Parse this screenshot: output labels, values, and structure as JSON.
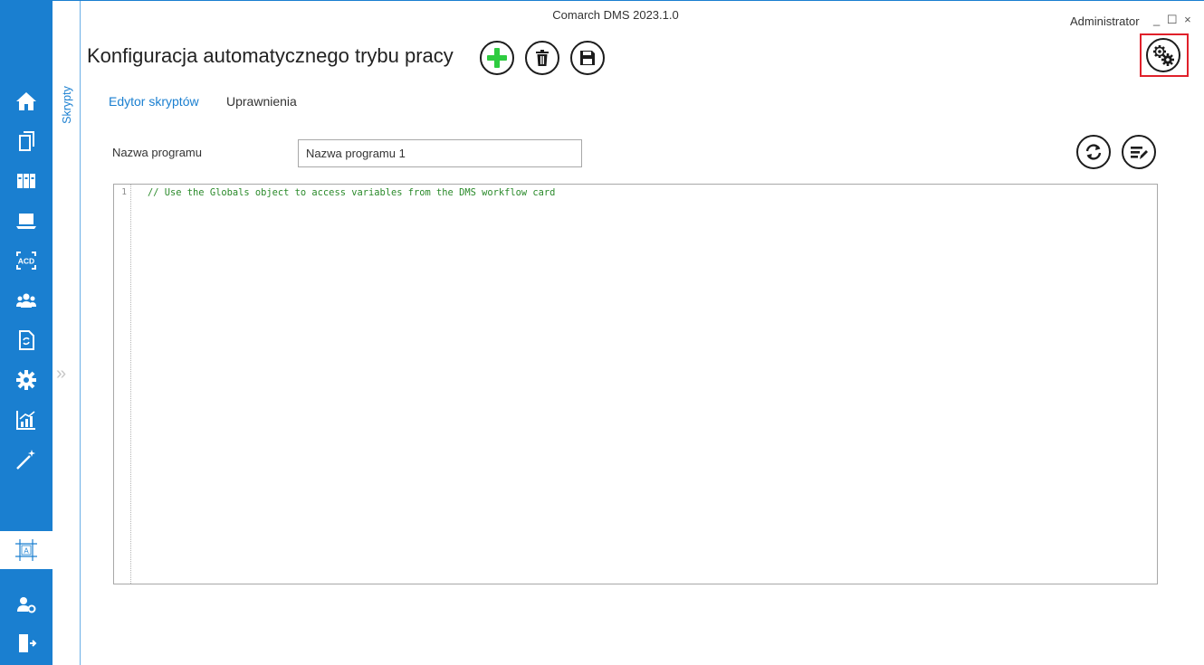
{
  "window": {
    "title": "Comarch DMS 2023.1.0",
    "user": "Administrator",
    "controls": "_ ☐ ×"
  },
  "page": {
    "title": "Konfiguracja automatycznego trybu pracy"
  },
  "toolbar": {
    "add_icon": "plus-icon",
    "delete_icon": "trash-icon",
    "save_icon": "floppy-icon",
    "config_icon": "gears-icon",
    "add_color": "#2ecc40"
  },
  "sidebar": {
    "items": [
      {
        "icon": "home-icon"
      },
      {
        "icon": "documents-icon"
      },
      {
        "icon": "binders-icon"
      },
      {
        "icon": "laptop-icon"
      },
      {
        "icon": "ocr-acd-icon"
      },
      {
        "icon": "users-group-icon"
      },
      {
        "icon": "document-sync-icon"
      },
      {
        "icon": "gear-icon"
      },
      {
        "icon": "chart-icon"
      },
      {
        "icon": "magic-wand-icon"
      },
      {
        "icon": "form-designer-icon",
        "active": true
      },
      {
        "icon": "user-settings-icon"
      },
      {
        "icon": "logout-icon"
      }
    ],
    "accent": "#1a7fd0"
  },
  "side_panel": {
    "tab_label": "Skrypty",
    "expand_icon": "double-chevron-right-icon"
  },
  "tabs": [
    {
      "label": "Edytor skryptów",
      "active": true
    },
    {
      "label": "Uprawnienia",
      "active": false
    }
  ],
  "form": {
    "name_label": "Nazwa programu",
    "name_value": "Nazwa programu 1",
    "refresh_icon": "refresh-icon",
    "format_icon": "format-lines-icon"
  },
  "editor": {
    "line_number": "1",
    "code": "// Use the Globals object to access variables from the DMS workflow card",
    "comment_color": "#2a8a2a"
  }
}
